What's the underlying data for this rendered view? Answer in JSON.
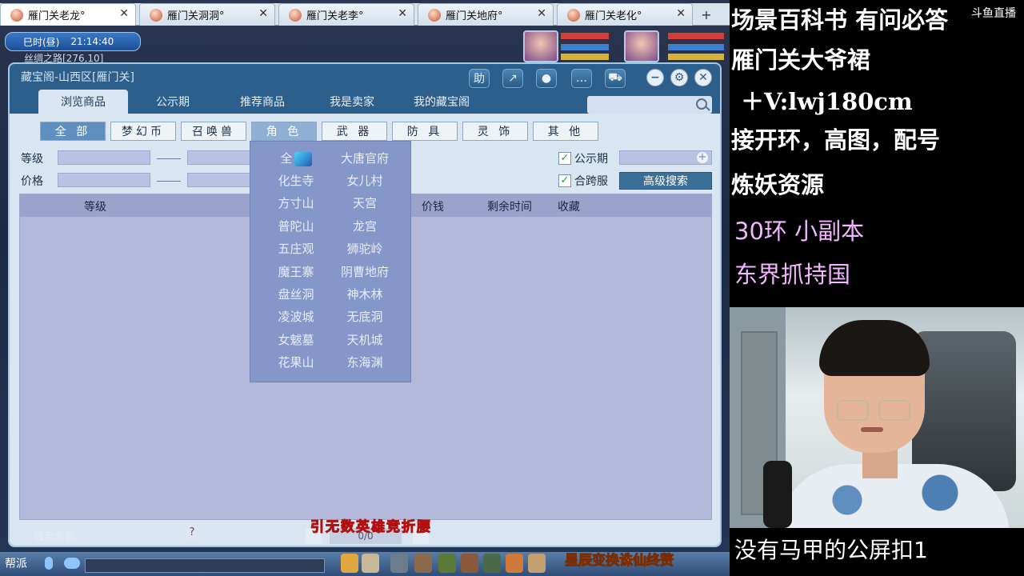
{
  "browser": {
    "tabs": [
      {
        "label": "雁门关老龙°",
        "active": true
      },
      {
        "label": "雁门关洞洞°",
        "active": false
      },
      {
        "label": "雁门关老李°",
        "active": false
      },
      {
        "label": "雁门关地府°",
        "active": false
      },
      {
        "label": "雁门关老化°",
        "active": false
      }
    ],
    "close_glyph": "✕",
    "add_glyph": "+"
  },
  "game": {
    "time_label": "巳时(昼)",
    "clock": "21:14:40",
    "map_coords": "丝绸之路[276,10]",
    "window": {
      "title": "藏宝阁-山西区[雁门关]",
      "help_btn": "助",
      "nav_tabs": [
        "浏览商品",
        "公示期",
        "推荐商品",
        "我是卖家",
        "我的藏宝阁"
      ],
      "categories": [
        "全 部",
        "梦幻币",
        "召唤兽",
        "角 色",
        "武 器",
        "防 具",
        "灵 饰",
        "其 他"
      ],
      "filters": {
        "level_label": "等级",
        "price_label": "价格",
        "public_label": "公示期",
        "cross_label": "合跨服",
        "adv_search": "高级搜索",
        "checked": "✓"
      },
      "table_headers": {
        "level": "等级",
        "price": "价钱",
        "remain": "剩余时间",
        "fav": "收藏"
      },
      "wallet_label": "钱包余额:",
      "help_icon_text": "?",
      "page_text": "0/0"
    },
    "dropdown": {
      "first": "全",
      "left": [
        "化生寺",
        "方寸山",
        "普陀山",
        "五庄观",
        "魔王寨",
        "盘丝洞",
        "凌波城",
        "女魃墓",
        "花果山"
      ],
      "right": [
        "大唐官府",
        "女儿村",
        "天宫",
        "龙宫",
        "狮驼岭",
        "阴曹地府",
        "神木林",
        "无底洞",
        "天机城",
        "东海渊"
      ]
    },
    "caption": "引无数英雄竞折腰",
    "chat_btn": "帮派",
    "promo": "星辰变换诛仙终赘"
  },
  "side": {
    "logo": "斗鱼直播",
    "lines": [
      "场景百科书 有问必答",
      "雁门关大爷裙",
      "＋V:lwj180cm",
      "接开环，高图，配号",
      "炼妖资源"
    ],
    "pink_lines": [
      "30环 小副本",
      "东界抓持国"
    ],
    "bottom": "没有马甲的公屏扣1"
  },
  "colors": {
    "accent": "#2c5f8c",
    "panel": "#d9e6f2",
    "dropdown": "#8596c8",
    "pink_text": "#f3b6ff"
  }
}
